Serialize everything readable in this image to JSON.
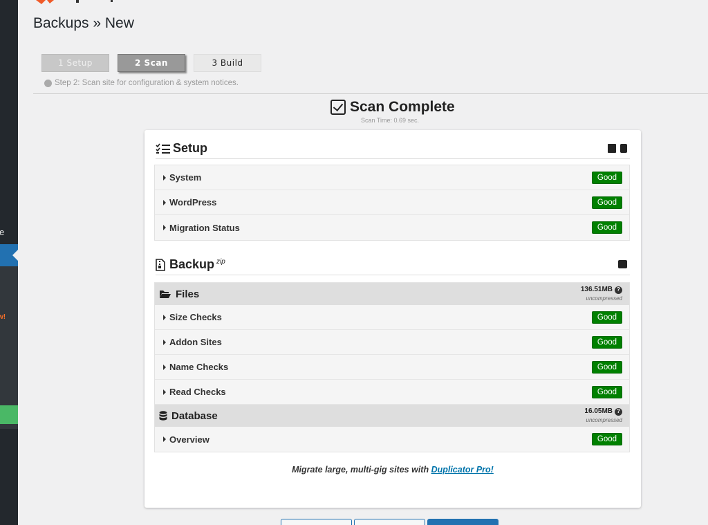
{
  "page": {
    "title": "Backups » New"
  },
  "steps": [
    {
      "label": "1 Setup"
    },
    {
      "label": "2 Scan"
    },
    {
      "label": "3 Build"
    }
  ],
  "step_description": "Step 2: Scan site for configuration & system notices.",
  "scan": {
    "title": "Scan Complete",
    "time": "Scan Time: 0.69 sec."
  },
  "setup": {
    "title": "Setup",
    "rows": [
      {
        "label": "System",
        "status": "Good"
      },
      {
        "label": "WordPress",
        "status": "Good"
      },
      {
        "label": "Migration Status",
        "status": "Good"
      }
    ]
  },
  "backup": {
    "title": "Backup",
    "format": "zip",
    "files": {
      "title": "Files",
      "size": "136.51MB",
      "note": "uncompressed",
      "rows": [
        {
          "label": "Size Checks",
          "status": "Good"
        },
        {
          "label": "Addon Sites",
          "status": "Good"
        },
        {
          "label": "Name Checks",
          "status": "Good"
        },
        {
          "label": "Read Checks",
          "status": "Good"
        }
      ]
    },
    "database": {
      "title": "Database",
      "size": "16.05MB",
      "note": "uncompressed",
      "rows": [
        {
          "label": "Overview",
          "status": "Good"
        }
      ]
    }
  },
  "promo": {
    "text": "Migrate large, multi-gig sites with ",
    "link": "Duplicator Pro!"
  },
  "sidebar": {
    "fragment_text": "e",
    "fragment_orange": "w!"
  },
  "colors": {
    "good": "#008000",
    "link": "#0073aa",
    "sidebar": "#23282d",
    "active": "#2271b1"
  },
  "icons": {
    "scan": "check-square-icon",
    "setup": "tasks-list-icon",
    "backup": "file-archive-icon",
    "files": "folder-open-icon",
    "database": "database-icon",
    "help": "question-circle-icon"
  }
}
